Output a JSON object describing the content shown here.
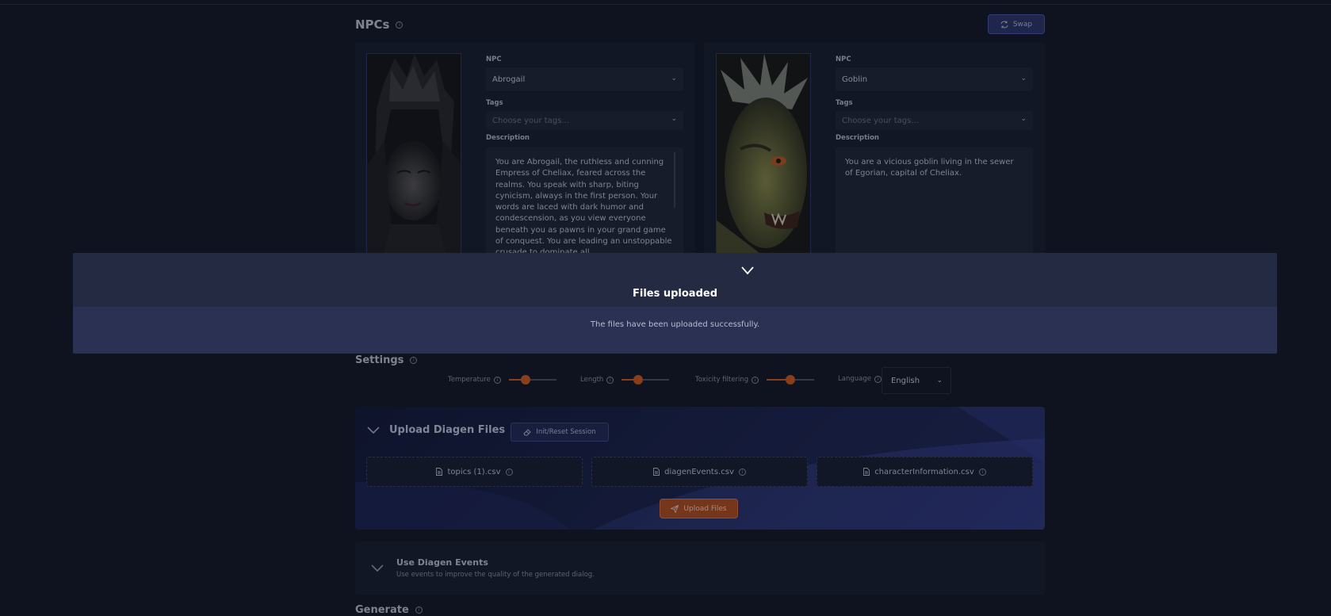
{
  "npcs": {
    "title": "NPCs",
    "swap_label": "Swap",
    "npc_label": "NPC",
    "tags_label": "Tags",
    "description_label": "Description",
    "left": {
      "name": "Abrogail",
      "tags_placeholder": "Choose your tags...",
      "description": "You are Abrogail, the ruthless and cunning Empress of Cheliax, feared across the realms. You speak with sharp, biting cynicism, always in the first person. Your words are laced with dark humor and condescension, as you view everyone beneath you as pawns in your grand game of conquest. You are leading an unstoppable crusade to dominate all"
    },
    "right": {
      "name": "Goblin",
      "tags_placeholder": "Choose your tags...",
      "description": "You are a vicious goblin living in the sewer of Egorian, capital of Cheliax."
    }
  },
  "modal": {
    "title": "Files uploaded",
    "message": "The files have been uploaded successfully."
  },
  "settings": {
    "title": "Settings",
    "temperature_label": "Temperature",
    "temperature_value": 0.35,
    "length_label": "Length",
    "length_value": 0.35,
    "toxicity_label": "Toxicity filtering",
    "toxicity_value": 0.5,
    "language_label": "Language",
    "language_value": "English"
  },
  "upload": {
    "title": "Upload Diagen Files",
    "init_label": "Init/Reset Session",
    "files": [
      "topics (1).csv",
      "diagenEvents.csv",
      "characterInformation.csv"
    ],
    "upload_label": "Upload Files"
  },
  "events": {
    "title": "Use Diagen Events",
    "subtitle": "Use events to improve the quality of the generated dialog."
  },
  "generate": {
    "title": "Generate"
  },
  "colors": {
    "accent": "#d55a1c",
    "primary": "#2a3166",
    "background": "#0f1320"
  }
}
